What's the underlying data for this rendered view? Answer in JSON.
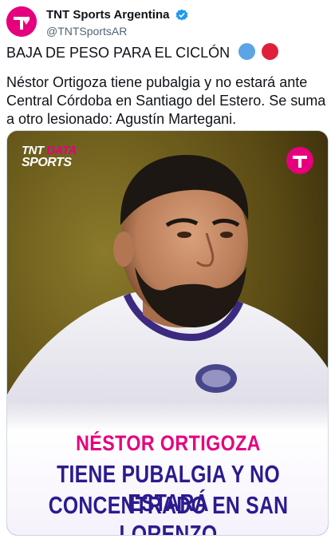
{
  "tweet": {
    "author_name": "TNT Sports Argentina",
    "handle": "@TNTSportsAR",
    "headline": "BAJA DE PESO PARA EL CICLÓN",
    "body": "Néstor Ortigoza tiene pubalgia y no estará ante Central Córdoba en Santiago del Estero. Se suma a otro lesionado: Agustín Martegani.",
    "emoji": [
      "blue-circle",
      "red-circle"
    ]
  },
  "media": {
    "brand_tnt": "TNT",
    "brand_data": "DATA",
    "brand_sports": "SPORTS",
    "caption_name": "NÉSTOR ORTIGOZA",
    "caption_line1": "TIENE PUBALGIA Y NO ESTARÁ",
    "caption_line2": "CONCENTRADO EN SAN LORENZO"
  },
  "colors": {
    "brand_pink": "#e6007e",
    "caption_navy": "#2b1b8e",
    "flag_blue": "#5ba4e6",
    "flag_red": "#e0203a",
    "verified_blue": "#1d9bf0"
  }
}
